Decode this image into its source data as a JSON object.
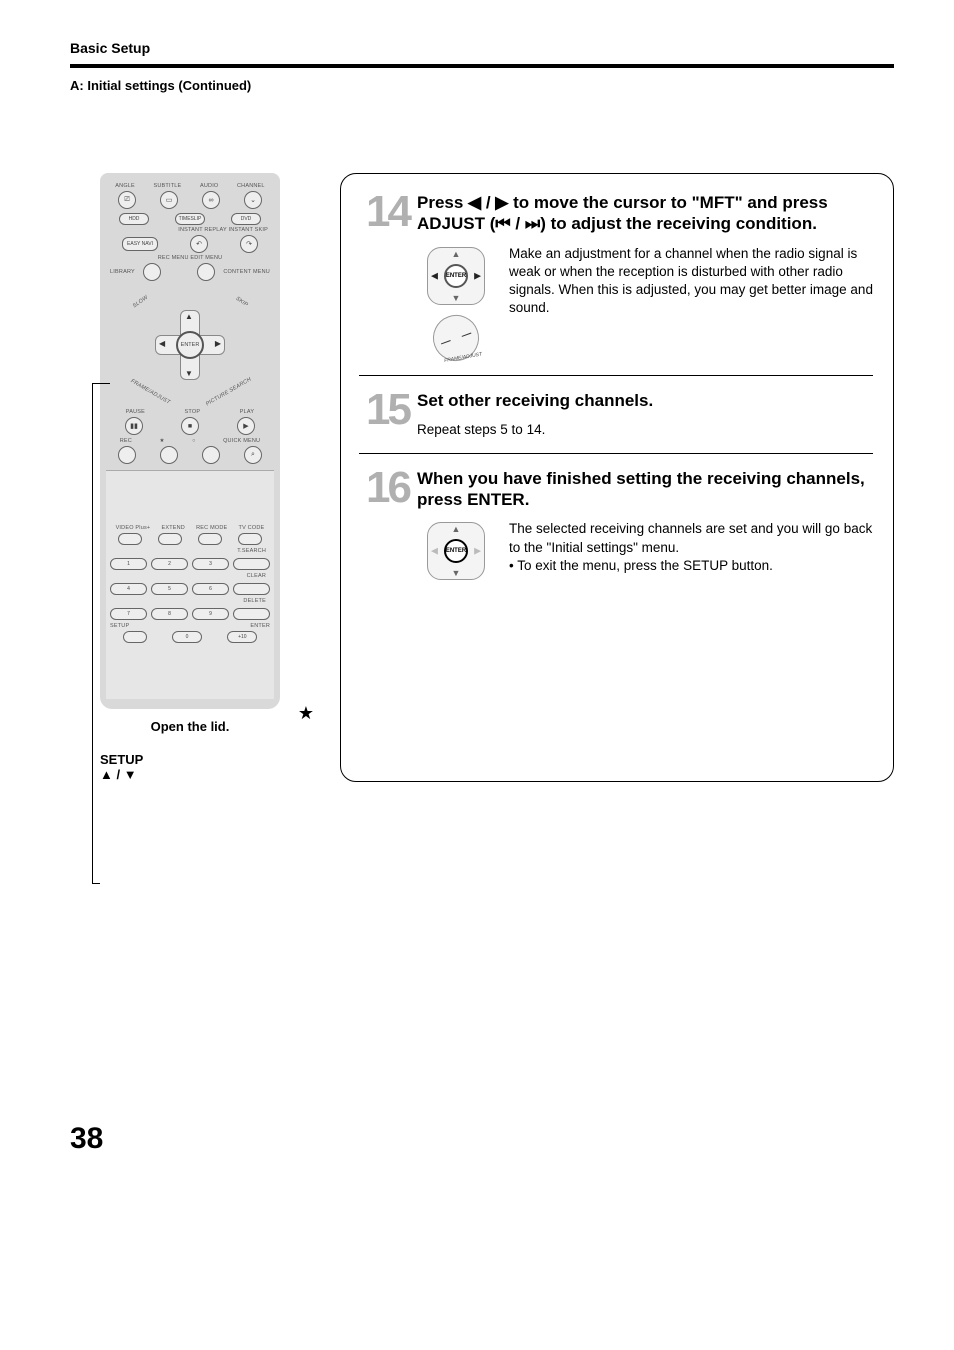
{
  "header": {
    "section": "Basic Setup",
    "subheading": "A: Initial settings (Continued)"
  },
  "page_number": "38",
  "remote": {
    "top_labels": [
      "ANGLE",
      "SUBTITLE",
      "AUDIO",
      "CHANNEL"
    ],
    "mode_buttons": [
      "HDD",
      "TIMESLIP",
      "DVD"
    ],
    "instant_labels": "INSTANT REPLAY  INSTANT SKIP",
    "easy_navi": "EASY NAVI",
    "rec_edit": "REC MENU  EDIT MENU",
    "library": "LIBRARY",
    "content_menu": "CONTENT MENU",
    "enter": "ENTER",
    "slow": "SLOW",
    "skip": "SKIP",
    "frame_adjust": "FRAME/ADJUST",
    "picture_search": "PICTURE SEARCH",
    "transport_labels": [
      "PAUSE",
      "STOP",
      "PLAY"
    ],
    "rec_row_labels": [
      "REC",
      "★",
      "○",
      "QUICK MENU"
    ],
    "lid": {
      "row_labels": [
        "VIDEO Plus+",
        "EXTEND",
        "REC MODE",
        "TV CODE"
      ],
      "tsearch": "T.SEARCH",
      "clear": "CLEAR",
      "delete": "DELETE",
      "setup": "SETUP",
      "enter": "ENTER",
      "digits": [
        "1",
        "2",
        "3",
        "4",
        "5",
        "6",
        "7",
        "8",
        "9",
        "0",
        "+10"
      ]
    },
    "open_lid": "Open the lid.",
    "callout_setup": "SETUP",
    "callout_arrows": "▲ / ▼"
  },
  "steps": {
    "s14": {
      "num": "14",
      "head_a": "Press ",
      "head_b": " to move the cursor to \"MFT\" and press ADJUST (",
      "head_c": ") to adjust the receiving condition.",
      "arrows_lr": "◀ / ▶",
      "adjust_sym": "⏮ / ⏭",
      "desc": "Make an adjustment for a channel when the radio signal is weak or when the reception is disturbed with other radio signals. When this is adjusted, you may get better image and sound.",
      "dpad_center": "ENTER",
      "adjust_label": "FRAME/ADJUST"
    },
    "s15": {
      "num": "15",
      "head": "Set other receiving channels.",
      "desc": "Repeat steps 5 to 14."
    },
    "s16": {
      "num": "16",
      "head": "When you have finished setting the receiving channels, press ENTER.",
      "desc1": "The selected receiving channels are set and you will go back to the \"Initial settings\" menu.",
      "desc2": "• To exit the menu, press the SETUP button.",
      "dpad_center": "ENTER"
    }
  }
}
